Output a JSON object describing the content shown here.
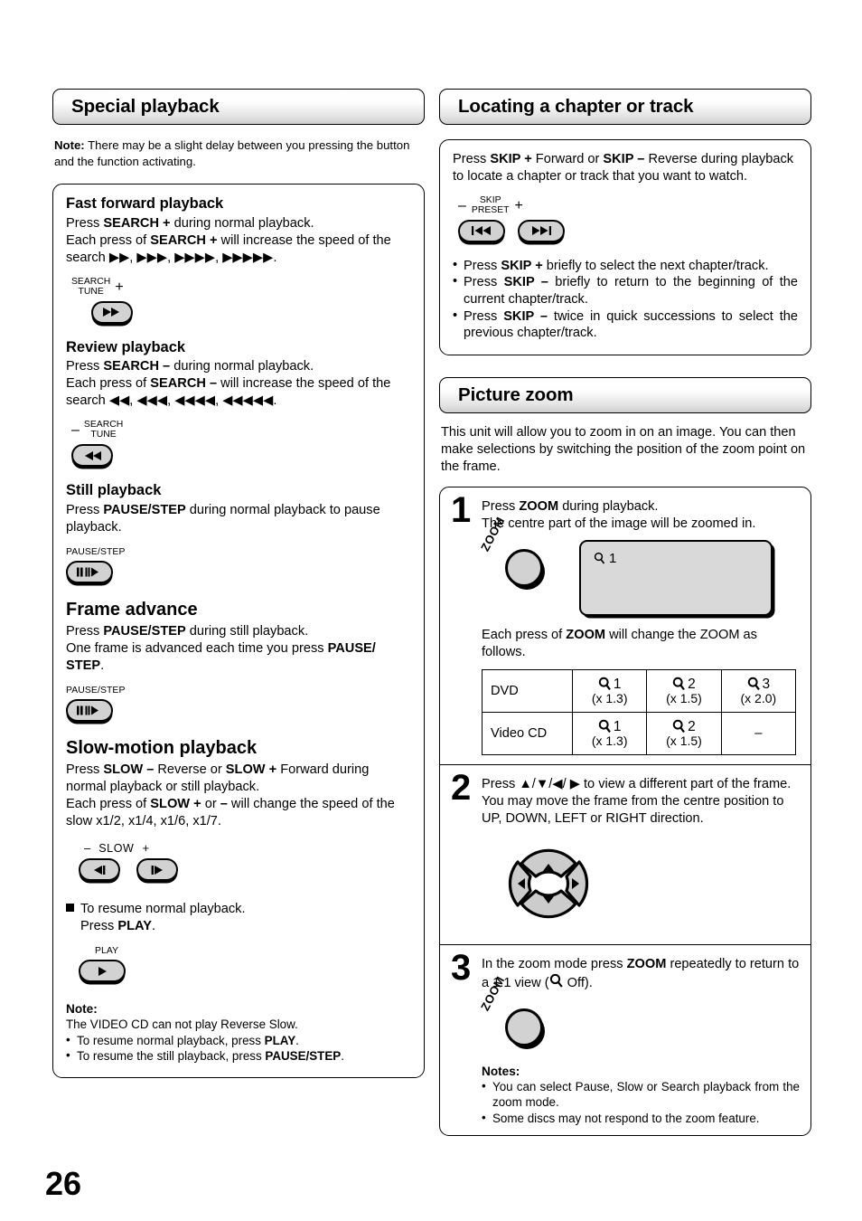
{
  "page_number": "26",
  "left_column": {
    "section_title": "Special playback",
    "note_prefix": "Note:",
    "note_text": " There may be a slight delay between you pressing the button and the function activating.",
    "blocks": {
      "fast_forward": {
        "heading": "Fast forward playback",
        "line1_a": "Press ",
        "line1_b": "SEARCH +",
        "line1_c": " during normal playback.",
        "line2_a": "Each press of ",
        "line2_b": "SEARCH +",
        "line2_c": " will increase the speed of the search ",
        "line2_d": ".",
        "button": {
          "label_top": "SEARCH",
          "label_bottom": "TUNE",
          "sign": "+",
          "glyph": "fast-forward"
        }
      },
      "review": {
        "heading": "Review playback",
        "line1_a": "Press ",
        "line1_b": "SEARCH –",
        "line1_c": " during normal playback.",
        "line2_a": "Each press of ",
        "line2_b": "SEARCH –",
        "line2_c": "  will increase the speed of the search ",
        "line2_d": ".",
        "button": {
          "label_top": "SEARCH",
          "label_bottom": "TUNE",
          "sign": "–",
          "glyph": "rewind"
        }
      },
      "still": {
        "heading": "Still playback",
        "line1_a": "Press ",
        "line1_b": "PAUSE/STEP",
        "line1_c": " during normal playback to pause playback.",
        "button": {
          "label": "PAUSE/STEP",
          "glyph": "pause-step"
        }
      },
      "frame_advance": {
        "heading": "Frame advance",
        "line1_a": "Press ",
        "line1_b": "PAUSE/STEP",
        "line1_c": " during still playback.",
        "line2_a": "One frame is advanced each time you press ",
        "line2_b": "PAUSE/ STEP",
        "line2_c": ".",
        "button": {
          "label": "PAUSE/STEP",
          "glyph": "pause-step"
        }
      },
      "slow_motion": {
        "heading": "Slow-motion playback",
        "line1_a": "Press ",
        "line1_b": "SLOW –",
        "line1_c": " Reverse or ",
        "line1_d": "SLOW +",
        "line1_e": " Forward during normal playback or still playback.",
        "line2_a": "Each press of ",
        "line2_b": "SLOW +",
        "line2_c": " or ",
        "line2_d": "–",
        "line2_e": " will change the speed of the slow x1/2, x1/4, x1/6, x1/7.",
        "button_label_minus": "–",
        "button_label_name": "SLOW",
        "button_label_plus": "+",
        "resume_line1": "To resume normal playback.",
        "resume_line2_a": "Press ",
        "resume_line2_b": "PLAY",
        "resume_line2_c": ".",
        "play_button": {
          "label": "PLAY",
          "glyph": "play"
        }
      },
      "bottom_note": {
        "heading": "Note:",
        "line1": "The VIDEO CD can not play Reverse Slow.",
        "bullets": [
          {
            "a": "To resume normal playback, press ",
            "b": "PLAY",
            "c": "."
          },
          {
            "a": "To resume the still playback, press ",
            "b": "PAUSE/STEP",
            "c": "."
          }
        ]
      }
    }
  },
  "right_column": {
    "locating": {
      "section_title": "Locating a chapter or track",
      "intro_a": "Press ",
      "intro_b": "SKIP +",
      "intro_c": " Forward or ",
      "intro_d": "SKIP –",
      "intro_e": " Reverse during playback to locate a chapter or track that you want to watch.",
      "button_label_minus": "–",
      "button_label_top": "SKIP",
      "button_label_bottom": "PRESET",
      "button_label_plus": "+",
      "bullets": [
        {
          "a": "Press ",
          "b": "SKIP +",
          "c": " briefly to select the next chapter/track."
        },
        {
          "a": "Press ",
          "b": "SKIP –",
          "c": " briefly to return to the beginning of the current chapter/track."
        },
        {
          "a": "Press ",
          "b": "SKIP –",
          "c": " twice in quick successions to select the previous chapter/track."
        }
      ]
    },
    "picture_zoom": {
      "section_title": "Picture zoom",
      "intro": "This unit will allow you to zoom in on an image. You can then make selections by switching the position of the zoom point on the frame.",
      "step1": {
        "number": "1",
        "line1_a": "Press ",
        "line1_b": "ZOOM",
        "line1_c": " during playback.",
        "line2": "The centre part of the image will be zoomed in.",
        "knob_label": "ZOOM",
        "screen_value": "1",
        "table_intro_a": "Each press of ",
        "table_intro_b": "ZOOM",
        "table_intro_c": " will change the ZOOM as follows.",
        "table": {
          "rows": [
            {
              "label": "DVD",
              "cells": [
                {
                  "level": "1",
                  "factor": "(x 1.3)"
                },
                {
                  "level": "2",
                  "factor": "(x 1.5)"
                },
                {
                  "level": "3",
                  "factor": "(x 2.0)"
                }
              ]
            },
            {
              "label": "Video CD",
              "cells": [
                {
                  "level": "1",
                  "factor": "(x 1.3)"
                },
                {
                  "level": "2",
                  "factor": "(x 1.5)"
                },
                {
                  "level": "–",
                  "factor": ""
                }
              ]
            }
          ]
        }
      },
      "step2": {
        "number": "2",
        "line1_a": "Press ",
        "line1_b": " to view a different part of the frame.",
        "line2": "You may move the frame from the centre position to  UP, DOWN, LEFT or RIGHT direction."
      },
      "step3": {
        "number": "3",
        "line1_a": "In the zoom mode press ",
        "line1_b": "ZOOM",
        "line1_c": " repeatedly to return to a 1:1 view (",
        "line1_d": " Off).",
        "knob_label": "ZOOM"
      },
      "notes": {
        "heading": "Notes:",
        "bullets": [
          "You can select Pause, Slow or Search playback from the zoom mode.",
          "Some discs may not respond to the zoom feature."
        ]
      }
    }
  }
}
